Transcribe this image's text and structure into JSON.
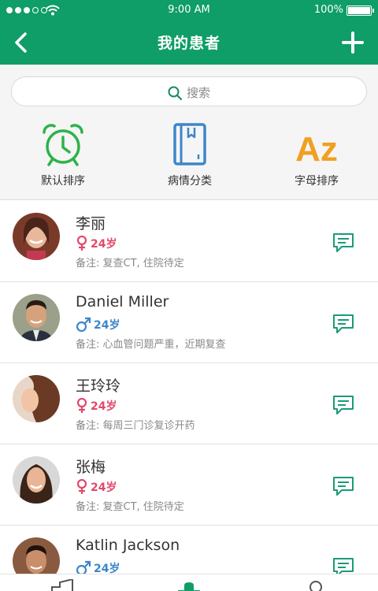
{
  "status_bar": {
    "time": "9:00 AM",
    "battery": "100%"
  },
  "nav": {
    "title": "我的患者"
  },
  "search": {
    "placeholder": "搜索"
  },
  "sort_options": [
    {
      "label": "默认排序",
      "icon": "alarm-clock-icon",
      "color": "#2db34a"
    },
    {
      "label": "病情分类",
      "icon": "notebook-icon",
      "color": "#3d86c9"
    },
    {
      "label": "字母排序",
      "icon": "az-icon",
      "color": "#f0a020",
      "icon_text": "Az"
    }
  ],
  "patients": [
    {
      "name": "李丽",
      "gender": "female",
      "age": "24岁",
      "note": "备注: 复查CT, 住院待定"
    },
    {
      "name": "Daniel Miller",
      "gender": "male",
      "age": "24岁",
      "note": "备注: 心血管问题严重，近期复查"
    },
    {
      "name": "王玲玲",
      "gender": "female",
      "age": "24岁",
      "note": "备注: 每周三门诊复诊开药"
    },
    {
      "name": "张梅",
      "gender": "female",
      "age": "24岁",
      "note": "备注: 复查CT, 住院待定"
    },
    {
      "name": "Katlin Jackson",
      "gender": "male",
      "age": "24岁",
      "note": ""
    }
  ],
  "colors": {
    "primary": "#0f9d68",
    "female": "#e04a6a",
    "male": "#3d86c9",
    "chat": "#1a9a7a"
  }
}
